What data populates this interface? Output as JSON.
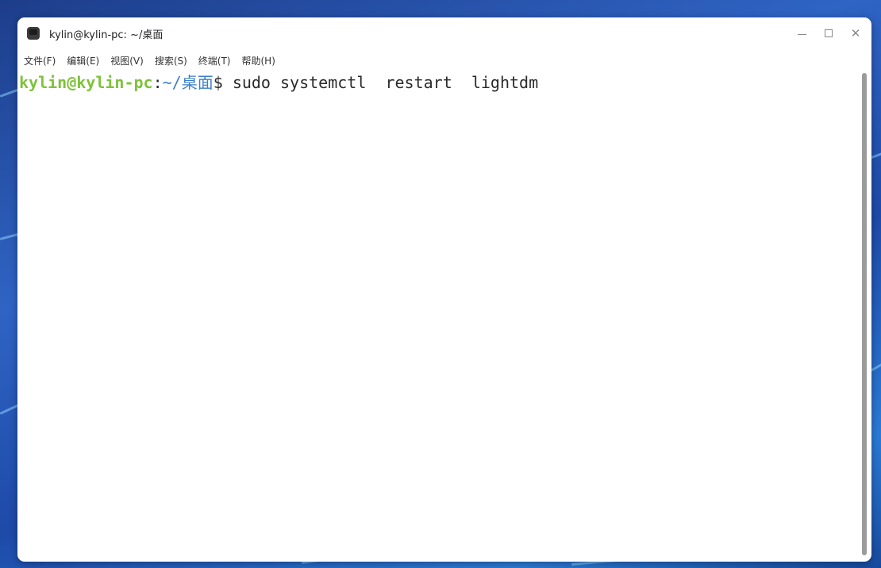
{
  "window": {
    "title": "kylin@kylin-pc: ~/桌面",
    "icon": "terminal-app-icon",
    "controls": [
      "minimize-icon",
      "maximize-icon",
      "close-icon"
    ]
  },
  "menu": {
    "items": [
      {
        "label": "文件(F)"
      },
      {
        "label": "编辑(E)"
      },
      {
        "label": "视图(V)"
      },
      {
        "label": "搜索(S)"
      },
      {
        "label": "终端(T)"
      },
      {
        "label": "帮助(H)"
      }
    ]
  },
  "terminal": {
    "prompt_user": "kylin@kylin-pc",
    "prompt_colon": ":",
    "prompt_path": "~/桌面",
    "prompt_dollar": "$ ",
    "command": "sudo systemctl  restart  lightdm"
  },
  "colors": {
    "prompt_user": "#7fc23a",
    "prompt_path": "#3d7fc9",
    "desktop_background": "#2f64c4"
  }
}
